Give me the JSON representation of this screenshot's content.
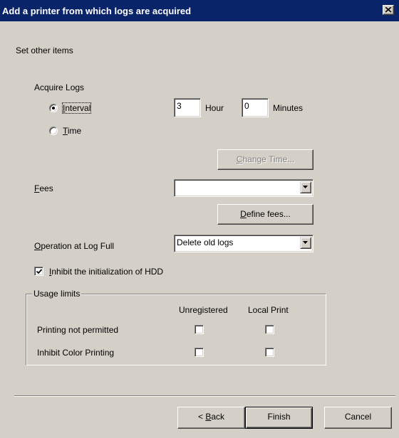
{
  "window": {
    "title": "Add a printer from which logs are acquired",
    "close_label": "×"
  },
  "heading": "Set other items",
  "acquire_logs": {
    "label": "Acquire Logs",
    "interval": {
      "label_hotkey": "I",
      "label_rest": "nterval",
      "selected": true,
      "hour_value": "3",
      "hour_label": "Hour",
      "minutes_value": "0",
      "minutes_label": "Minutes"
    },
    "time": {
      "label_hotkey": "T",
      "label_rest": "ime",
      "selected": false
    },
    "change_time_button": {
      "hotkey": "C",
      "rest": "hange Time...",
      "enabled": false
    }
  },
  "fees": {
    "label_hotkey": "F",
    "label_rest": "ees",
    "value": "",
    "define_button": {
      "hotkey": "D",
      "rest": "efine fees..."
    }
  },
  "operation_at_log_full": {
    "label_hotkey": "O",
    "label_rest": "peration at Log Full",
    "value": "Delete old logs"
  },
  "inhibit_hdd": {
    "label_hotkey": "I",
    "label_rest": "nhibit the initialization of HDD",
    "checked": true
  },
  "usage_limits": {
    "title": "Usage limits",
    "columns": [
      "Unregistered",
      "Local Print"
    ],
    "rows": [
      {
        "label": "Printing not permitted",
        "unregistered": false,
        "local_print": false
      },
      {
        "label": "Inhibit Color Printing",
        "unregistered": false,
        "local_print": false
      }
    ]
  },
  "footer": {
    "back": {
      "prefix": "< ",
      "hotkey": "B",
      "rest": "ack"
    },
    "finish": "Finish",
    "cancel": "Cancel"
  }
}
